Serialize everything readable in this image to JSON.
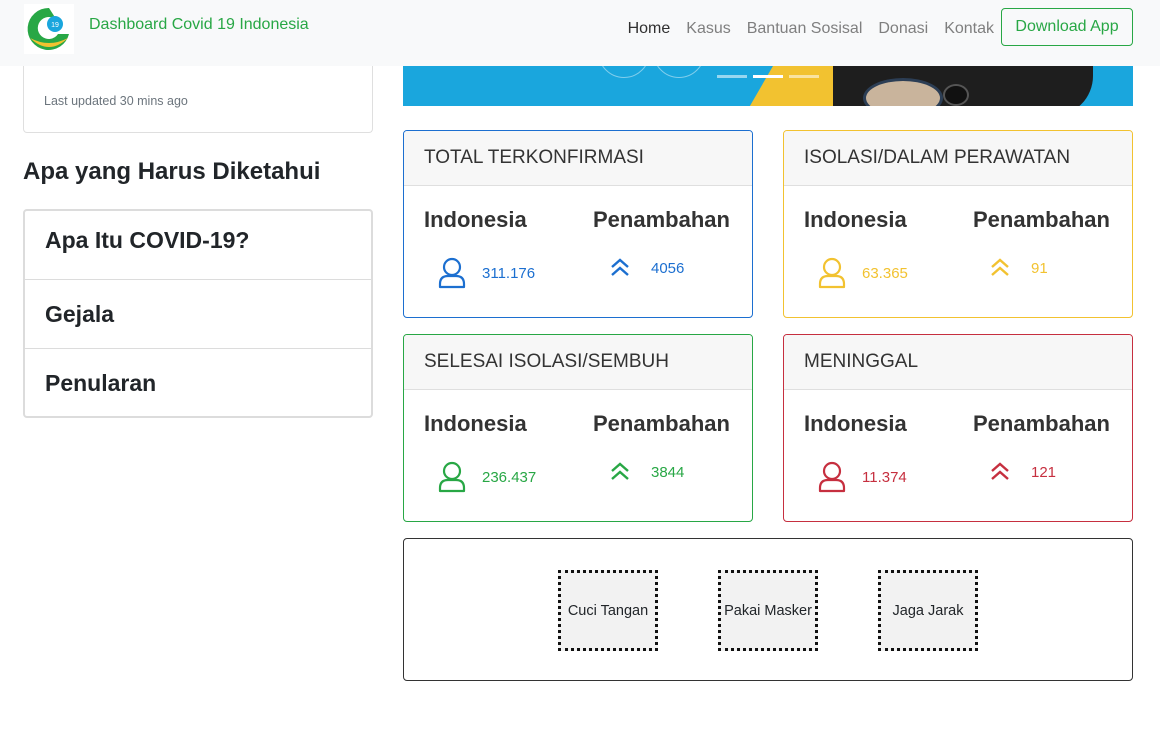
{
  "navbar": {
    "brand": "Dashboard Covid 19 Indonesia",
    "logo_badge": "19",
    "links": [
      "Home",
      "Kasus",
      "Bantuan Sosisal",
      "Donasi",
      "Kontak"
    ],
    "download_label": "Download App"
  },
  "sidebar": {
    "last_updated": "Last updated 30 mins ago",
    "section_title": "Apa yang Harus Diketahui",
    "accordion": [
      "Apa Itu COVID-19?",
      "Gejala",
      "Penularan"
    ]
  },
  "colors": {
    "brand_green": "#28a745",
    "blue": "#1c6fd0",
    "yellow": "#f2c230",
    "green": "#28a745",
    "red": "#c62f3f",
    "hero_blue": "#1aa6dd"
  },
  "carousel": {
    "slide_count": 3,
    "active_index": 1
  },
  "stats": [
    {
      "title": "TOTAL TERKONFIRMASI",
      "left_label": "Indonesia",
      "left_value": "311.176",
      "right_label": "Penambahan",
      "right_value": "4056",
      "color": "#1c6fd0",
      "icons": [
        "user-icon",
        "double-chevron-up-icon"
      ]
    },
    {
      "title": "ISOLASI/DALAM PERAWATAN",
      "left_label": "Indonesia",
      "left_value": "63.365",
      "right_label": "Penambahan",
      "right_value": "91",
      "color": "#f2c230",
      "icons": [
        "user-icon",
        "double-chevron-up-icon"
      ]
    },
    {
      "title": "SELESAI ISOLASI/SEMBUH",
      "left_label": "Indonesia",
      "left_value": "236.437",
      "right_label": "Penambahan",
      "right_value": "3844",
      "color": "#28a745",
      "icons": [
        "user-icon",
        "double-chevron-up-icon"
      ]
    },
    {
      "title": "MENINGGAL",
      "left_label": "Indonesia",
      "left_value": "11.374",
      "right_label": "Penambahan",
      "right_value": "121",
      "color": "#c62f3f",
      "icons": [
        "user-icon",
        "double-chevron-up-icon"
      ]
    }
  ],
  "tips": [
    "Cuci Tangan",
    "Pakai Masker",
    "Jaga Jarak"
  ]
}
